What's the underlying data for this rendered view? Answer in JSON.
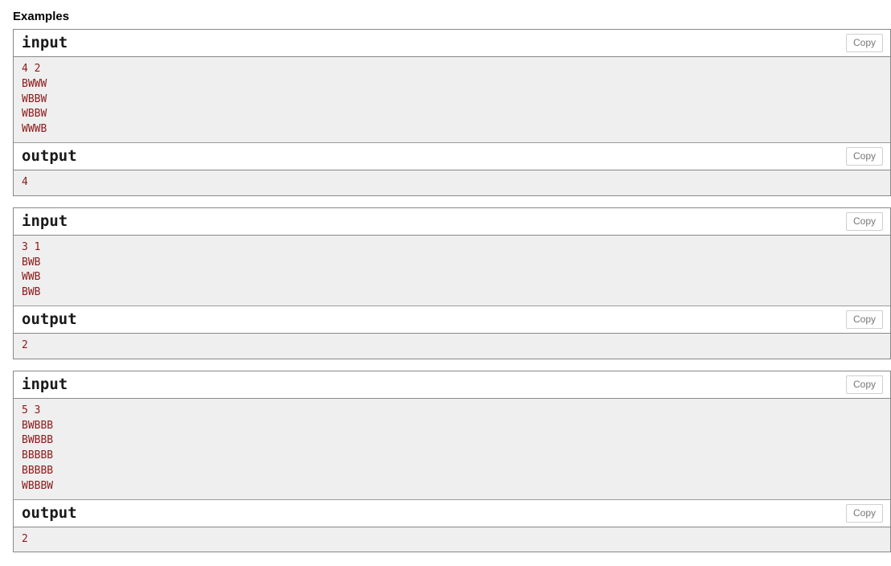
{
  "section": {
    "title": "Examples"
  },
  "labels": {
    "input": "input",
    "output": "output",
    "copy": "Copy"
  },
  "colors": {
    "code_text": "#8B1A1A",
    "code_background": "#efefef",
    "border": "#888888",
    "copy_border": "#cfcfcf",
    "copy_text": "#777777"
  },
  "examples": [
    {
      "input": "4 2\nBWWW\nWBBW\nWBBW\nWWWB",
      "output": "4"
    },
    {
      "input": "3 1\nBWB\nWWB\nBWB",
      "output": "2"
    },
    {
      "input": "5 3\nBWBBB\nBWBBB\nBBBBB\nBBBBB\nWBBBW",
      "output": "2"
    }
  ]
}
